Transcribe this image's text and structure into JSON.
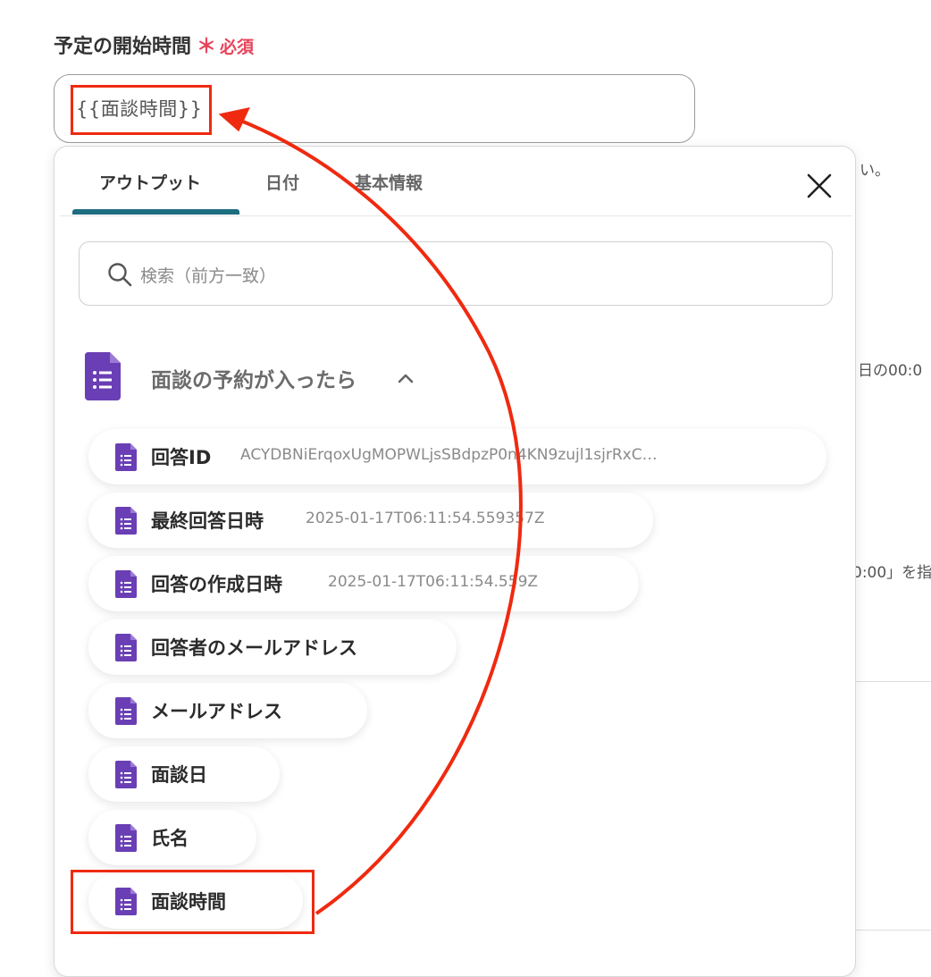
{
  "field": {
    "label": "予定の開始時間",
    "required_star": "＊",
    "required_text": "必須",
    "value": "{{面談時間}}"
  },
  "background": {
    "frag1": "い。",
    "frag2": "日の00:0",
    "frag3": "0:00」を指"
  },
  "popup": {
    "tabs": [
      {
        "label": "アウトプット",
        "active": true
      },
      {
        "label": "日付",
        "active": false
      },
      {
        "label": "基本情報",
        "active": false
      }
    ],
    "search_placeholder": "検索（前方一致）",
    "section_title": "面談の予約が入ったら",
    "items": [
      {
        "name": "回答ID",
        "value": "ACYDBNiErqoxUgMOPWLjsSBdpzP0n4KN9zujl1sjrRxC…"
      },
      {
        "name": "最終回答日時",
        "value": "2025-01-17T06:11:54.559357Z"
      },
      {
        "name": "回答の作成日時",
        "value": "2025-01-17T06:11:54.559Z"
      },
      {
        "name": "回答者のメールアドレス",
        "value": ""
      },
      {
        "name": "メールアドレス",
        "value": ""
      },
      {
        "name": "面談日",
        "value": ""
      },
      {
        "name": "氏名",
        "value": ""
      },
      {
        "name": "面談時間",
        "value": ""
      }
    ]
  },
  "colors": {
    "accent_tab": "#1d6e80",
    "form_icon": "#6a3fb5",
    "required": "#e8445a",
    "annotation": "#ef2a10"
  }
}
